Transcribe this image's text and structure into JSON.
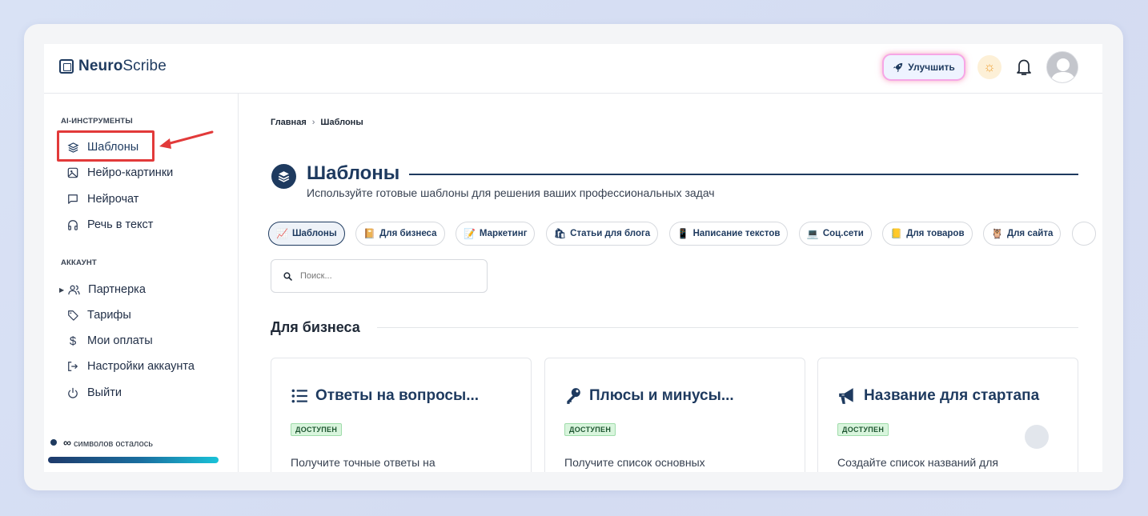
{
  "app": {
    "logo_bold": "Neuro",
    "logo_rest": "Scribe",
    "upgrade_label": "Улучшить"
  },
  "sidebar": {
    "ai_label": "AI-ИНСТРУМЕНТЫ",
    "ai_items": [
      {
        "label": "Шаблоны",
        "icon": "layers-icon"
      },
      {
        "label": "Нейро-картинки",
        "icon": "image-icon"
      },
      {
        "label": "Нейрочат",
        "icon": "chat-icon"
      },
      {
        "label": "Речь в текст",
        "icon": "headphones-icon"
      }
    ],
    "account_label": "АККАУНТ",
    "account_items": [
      {
        "label": "Партнерка",
        "icon": "users-icon"
      },
      {
        "label": "Тарифы",
        "icon": "tag-icon"
      },
      {
        "label": "Мои оплаты",
        "icon": "dollar-icon"
      },
      {
        "label": "Настройки аккаунта",
        "icon": "login-icon"
      },
      {
        "label": "Выйти",
        "icon": "power-icon"
      }
    ],
    "credits_symbol": "∞",
    "credits_text": "символов осталось"
  },
  "main": {
    "breadcrumb": [
      "Главная",
      "Шаблоны"
    ],
    "title": "Шаблоны",
    "subtitle": "Используйте готовые шаблоны для решения ваших профессиональных задач",
    "chips": [
      {
        "label": "Шаблоны",
        "emoji": "📈",
        "active": true
      },
      {
        "label": "Для бизнеса",
        "emoji": "📔"
      },
      {
        "label": "Маркетинг",
        "emoji": "📝"
      },
      {
        "label": "Статьи для блога",
        "emoji": "🛍"
      },
      {
        "label": "Написание текстов",
        "emoji": "📱"
      },
      {
        "label": "Соц.сети",
        "emoji": "💻"
      },
      {
        "label": "Для товаров",
        "emoji": "📒"
      },
      {
        "label": "Для сайта",
        "emoji": "🦉"
      }
    ],
    "search_placeholder": "Поиск...",
    "section_title": "Для бизнеса",
    "cards": [
      {
        "title": "Ответы на вопросы...",
        "icon": "list-icon",
        "badge": "ДОСТУПЕН",
        "desc": "Получите точные ответы на"
      },
      {
        "title": "Плюсы и минусы...",
        "icon": "key-icon",
        "badge": "ДОСТУПЕН",
        "desc": "Получите список основных"
      },
      {
        "title": "Название для стартапа",
        "icon": "megaphone-icon",
        "badge": "ДОСТУПЕН",
        "desc": "Создайте список названий для"
      }
    ]
  },
  "colors": {
    "brand": "#1e3a5f",
    "highlight": "#e23a3a",
    "badge_bg": "#d9f5dd"
  }
}
